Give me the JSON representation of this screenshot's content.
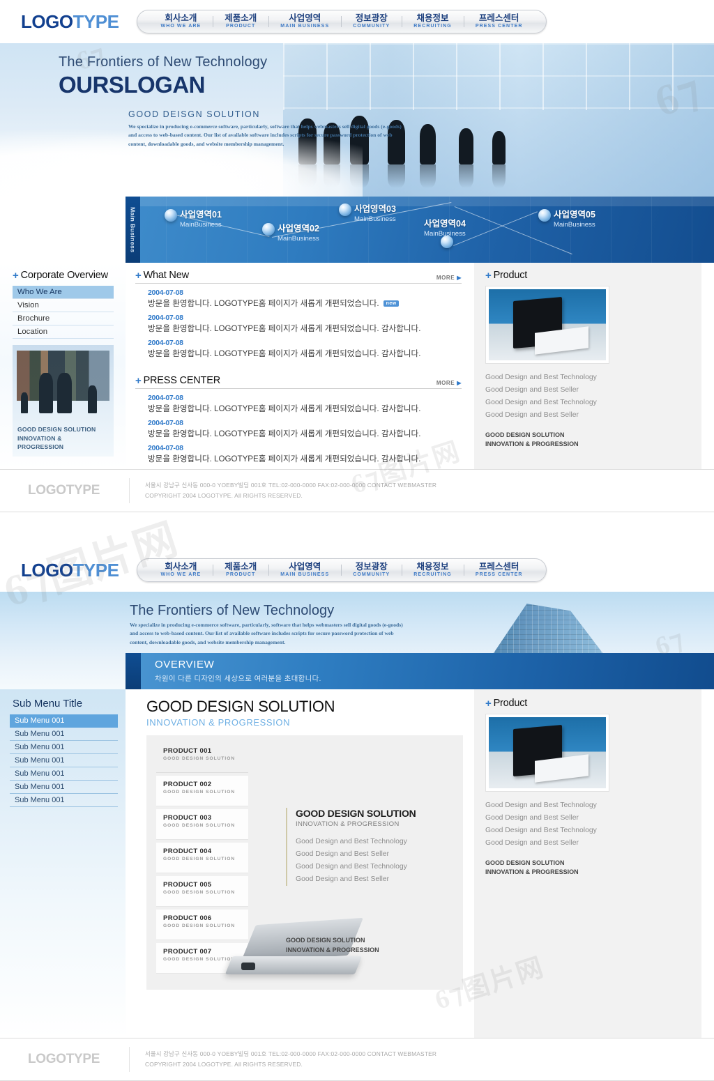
{
  "brand": {
    "logo_part1": "LOGO",
    "logo_part2": "TYPE",
    "footer_logo": "LOGOTYPE"
  },
  "nav": {
    "items": [
      {
        "ko": "회사소개",
        "en": "WHO WE ARE"
      },
      {
        "ko": "제품소개",
        "en": "PRODUCT"
      },
      {
        "ko": "사업영역",
        "en": "MAIN BUSINESS"
      },
      {
        "ko": "정보광장",
        "en": "COMMUNITY"
      },
      {
        "ko": "채용정보",
        "en": "RECRUITING"
      },
      {
        "ko": "프레스센터",
        "en": "PRESS CENTER"
      }
    ]
  },
  "hero": {
    "line1": "The Frontiers of New Technology",
    "slogan": "OURSLOGAN",
    "sub_title": "GOOD DEISGN SOLUTION",
    "sub_body": "We specialize in producing e-commerce software, particularly, software that helps webmasters sell digital goods (e-goods) and access to web-based content. Our list of available software includes scripts for secure password protection of web content, downloadable goods, and website membership management."
  },
  "main_business": {
    "side_label": "Main Business",
    "nodes": [
      {
        "ko": "사업영역01",
        "en": "MainBusiness"
      },
      {
        "ko": "사업영역02",
        "en": "MainBusiness"
      },
      {
        "ko": "사업영역03",
        "en": "MainBusiness"
      },
      {
        "ko": "사업영역04",
        "en": "MainBusiness"
      },
      {
        "ko": "사업영역05",
        "en": "MainBusiness"
      }
    ]
  },
  "corporate_overview": {
    "title": "Corporate Overview",
    "items": [
      {
        "label": "Who We Are",
        "active": true
      },
      {
        "label": "Vision",
        "active": false
      },
      {
        "label": "Brochure",
        "active": false
      },
      {
        "label": "Location",
        "active": false
      }
    ],
    "photo_caption_line1": "GOOD DESIGN SOLUTION",
    "photo_caption_line2": "INNOVATION &",
    "photo_caption_line3": "PROGRESSION"
  },
  "what_new": {
    "title": "What New",
    "more_label": "MORE",
    "items": [
      {
        "date": "2004-07-08",
        "text": "방문을 환영합니다. LOGOTYPE홈 페이지가 새롭게 개편되었습니다.",
        "badge": "new"
      },
      {
        "date": "2004-07-08",
        "text": "방문을 환영합니다. LOGOTYPE홈 페이지가 새롭게 개편되었습니다. 감사합니다.",
        "badge": ""
      },
      {
        "date": "2004-07-08",
        "text": "방문을 환영합니다. LOGOTYPE홈 페이지가 새롭게 개편되었습니다. 감사합니다.",
        "badge": ""
      }
    ]
  },
  "press_center": {
    "title": "PRESS CENTER",
    "more_label": "MORE",
    "items": [
      {
        "date": "2004-07-08",
        "text": "방문을 환영합니다. LOGOTYPE홈 페이지가 새롭게 개편되었습니다. 감사합니다."
      },
      {
        "date": "2004-07-08",
        "text": "방문을 환영합니다. LOGOTYPE홈 페이지가 새롭게 개편되었습니다. 감사합니다."
      },
      {
        "date": "2004-07-08",
        "text": "방문을 환영합니다. LOGOTYPE홈 페이지가 새롭게 개편되었습니다. 감사합니다."
      }
    ]
  },
  "product_panel": {
    "title": "Product",
    "lines": [
      "Good Design and Best Technology",
      "Good Design and Best Seller",
      "Good Design and Best Technology",
      "Good Design and Best Seller"
    ],
    "foot_line1": "GOOD DESIGN SOLUTION",
    "foot_line2": "INNOVATION & PROGRESSION"
  },
  "footer": {
    "address": "서울시 강남구 신사동 000-0 YOEBY빌딩 001호 TEL:02-000-0000 FAX:02-000-0000 CONTACT WEBMASTER",
    "copyright": "COPYRIGHT 2004 LOGOTYPE. All RIGHTS RESERVED."
  },
  "page2": {
    "hero_line1": "The Frontiers of New Technology",
    "hero_body": "We specialize in producing e-commerce software, particularly, software that helps webmasters sell digital goods (e-goods) and access to web-based content. Our list of available software includes scripts for secure password protection of web content, downloadable goods, and website membership management.",
    "overview_title": "OVERVIEW",
    "overview_desc": "차원이 다른 디자인의 세상으로 여러분을 초대합니다.",
    "submenu_title": "Sub Menu Title",
    "submenu_items": [
      {
        "label": "Sub Menu 001",
        "active": true
      },
      {
        "label": "Sub Menu 001",
        "active": false
      },
      {
        "label": "Sub Menu 001",
        "active": false
      },
      {
        "label": "Sub Menu 001",
        "active": false
      },
      {
        "label": "Sub Menu 001",
        "active": false
      },
      {
        "label": "Sub Menu 001",
        "active": false
      },
      {
        "label": "Sub Menu 001",
        "active": false
      }
    ],
    "content_title": "GOOD DESIGN SOLUTION",
    "content_subtitle": "INNOVATION & PROGRESSION",
    "products": [
      {
        "name": "PRODUCT 001",
        "desc": "GOOD DESIGN SOLUTION"
      },
      {
        "name": "PRODUCT 002",
        "desc": "GOOD DESIGN SOLUTION"
      },
      {
        "name": "PRODUCT 003",
        "desc": "GOOD DESIGN SOLUTION"
      },
      {
        "name": "PRODUCT 004",
        "desc": "GOOD DESIGN SOLUTION"
      },
      {
        "name": "PRODUCT 005",
        "desc": "GOOD DESIGN SOLUTION"
      },
      {
        "name": "PRODUCT 006",
        "desc": "GOOD DESIGN SOLUTION"
      },
      {
        "name": "PRODUCT 007",
        "desc": "GOOD DESIGN SOLUTION"
      }
    ],
    "detail_title": "GOOD DESIGN SOLUTION",
    "detail_subtitle": "INNOVATION & PROGRESSION",
    "detail_lines": [
      "Good Design and Best Technology",
      "Good Design and Best Seller",
      "Good Design and Best Technology",
      "Good Design and Best Seller"
    ],
    "detail_foot_line1": "GOOD DESIGN SOLUTION",
    "detail_foot_line2": "INNOVATION & PROGRESSION"
  },
  "colors": {
    "brand_dark": "#12408f",
    "brand_light": "#4f8fd4",
    "accent": "#2f79c9",
    "band_blue": "#1f62a8",
    "panel_gray": "#f2f2f2"
  }
}
